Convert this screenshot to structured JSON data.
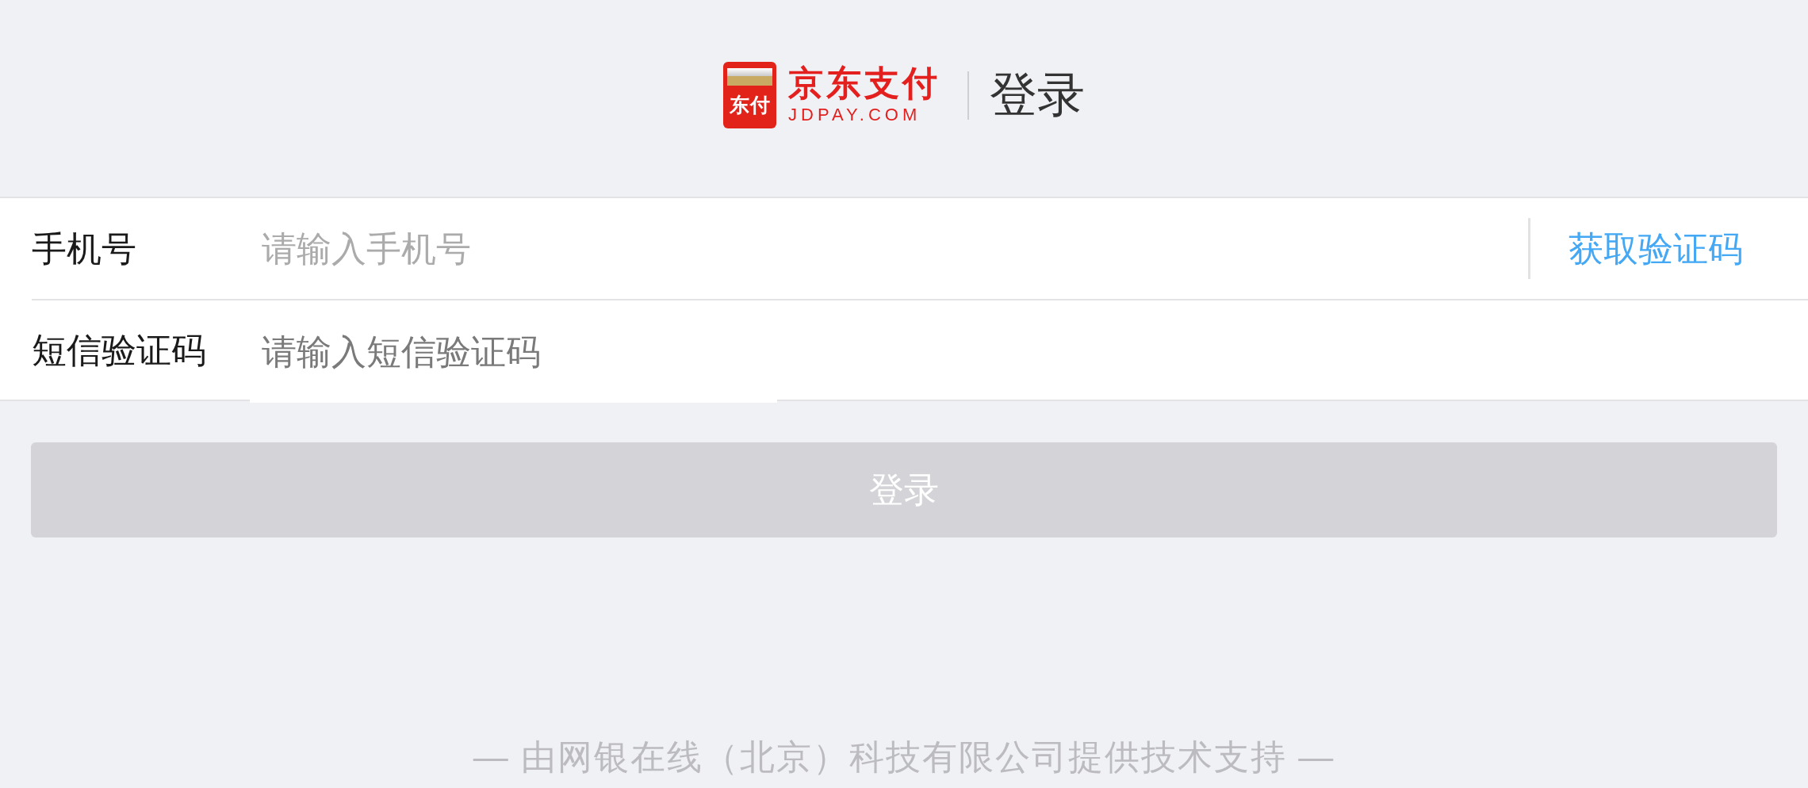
{
  "header": {
    "logo": {
      "badge_text": "东付",
      "name": "京东支付",
      "domain": "JDPAY.COM"
    },
    "title": "登录"
  },
  "form": {
    "rows": [
      {
        "label": "手机号",
        "placeholder": "请输入手机号",
        "action": "获取验证码"
      },
      {
        "label": "短信验证码",
        "placeholder": "请输入短信验证码"
      }
    ]
  },
  "submit_button": {
    "label": "登录",
    "disabled": true
  },
  "footer": "— 由网银在线（北京）科技有限公司提供技术支持 —"
}
